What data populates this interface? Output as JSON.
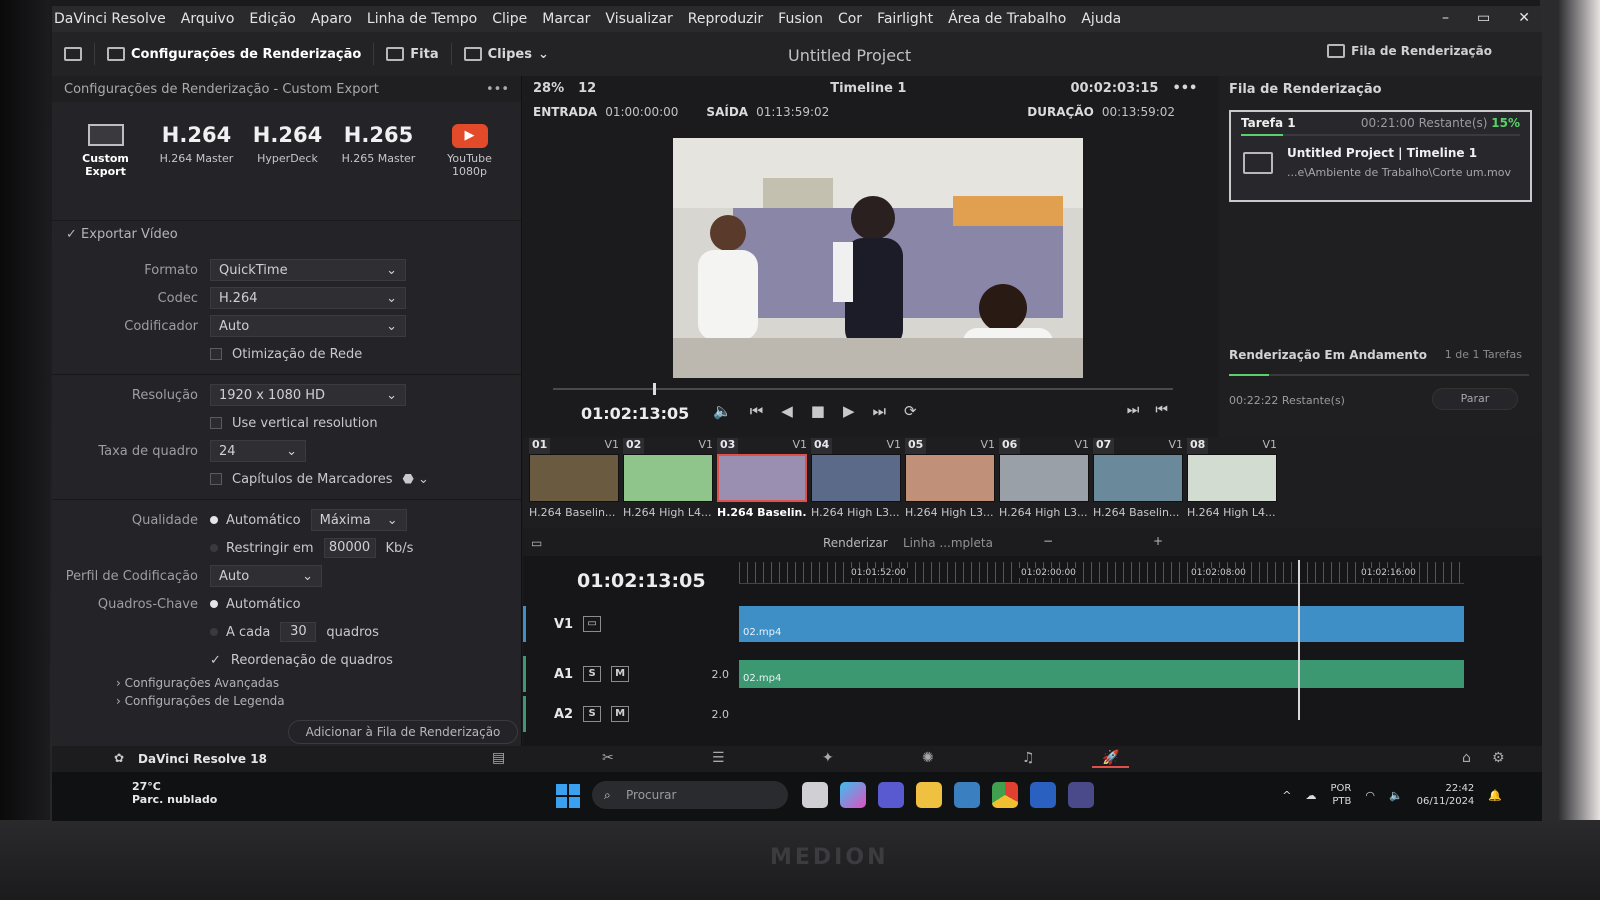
{
  "menu": [
    "DaVinci Resolve",
    "Arquivo",
    "Edição",
    "Aparo",
    "Linha de Tempo",
    "Clipe",
    "Marcar",
    "Visualizar",
    "Reproduzir",
    "Fusion",
    "Cor",
    "Fairlight",
    "Área de Trabalho",
    "Ajuda"
  ],
  "toolbar": {
    "render_settings": "Configurações de Renderização",
    "tape": "Fita",
    "clips": "Clipes",
    "project_title": "Untitled Project",
    "render_queue": "Fila de Renderização"
  },
  "left_panel": {
    "header": "Configurações de Renderização - Custom Export",
    "presets": [
      {
        "big": "",
        "label": "Custom Export"
      },
      {
        "big": "H.264",
        "label": "H.264 Master"
      },
      {
        "big": "H.264",
        "label": "HyperDeck"
      },
      {
        "big": "H.265",
        "label": "H.265 Master"
      },
      {
        "big": "",
        "label": "YouTube 1080p"
      }
    ],
    "export_video": "Exportar Vídeo",
    "format_label": "Formato",
    "format_value": "QuickTime",
    "codec_label": "Codec",
    "codec_value": "H.264",
    "encoder_label": "Codificador",
    "encoder_value": "Auto",
    "net_opt": "Otimização de Rede",
    "resolution_label": "Resolução",
    "resolution_value": "1920 x 1080 HD",
    "vertical_res": "Use vertical resolution",
    "framerate_label": "Taxa de quadro",
    "framerate_value": "24",
    "chapters": "Capítulos de Marcadores",
    "quality_label": "Qualidade",
    "quality_auto": "Automático",
    "quality_value": "Máxima",
    "restrict": "Restringir em",
    "restrict_value": "80000",
    "restrict_unit": "Kb/s",
    "profile_label": "Perfil de Codificação",
    "profile_value": "Auto",
    "keyframes_label": "Quadros-Chave",
    "keyframes_auto": "Automático",
    "every": "A cada",
    "every_value": "30",
    "every_unit": "quadros",
    "reorder": "Reordenação de quadros",
    "advanced": "Configurações Avançadas",
    "subtitles": "Configurações de Legenda",
    "add_queue": "Adicionar à Fila de Renderização"
  },
  "viewer": {
    "zoom": "28%",
    "frames": "12",
    "timeline_name": "Timeline 1",
    "tc_top": "00:02:03:15",
    "in_label": "ENTRADA",
    "in_value": "01:00:00:00",
    "out_label": "SAÍDA",
    "out_value": "01:13:59:02",
    "dur_label": "DURAÇÃO",
    "dur_value": "00:13:59:02",
    "timecode": "01:02:13:05"
  },
  "render_queue": {
    "title": "Fila de Renderização",
    "job_name": "Tarefa 1",
    "job_remaining": "00:21:00 Restante(s)",
    "job_percent": "15%",
    "job_progress": 0.15,
    "job_project": "Untitled Project | Timeline 1",
    "job_path": "...e\\Ambiente de Trabalho\\Corte um.mov",
    "in_progress": "Renderização Em Andamento",
    "task_count": "1 de 1 Tarefas",
    "remaining": "00:22:22 Restante(s)",
    "stop": "Parar"
  },
  "clips": [
    {
      "num": "01",
      "track": "V1",
      "name": "H.264 Baselin...",
      "color": "#6a5a40"
    },
    {
      "num": "02",
      "track": "V1",
      "name": "H.264 High L4...",
      "color": "#8fc48a"
    },
    {
      "num": "03",
      "track": "V1",
      "name": "H.264 Baselin...",
      "color": "#9a8fb0"
    },
    {
      "num": "04",
      "track": "V1",
      "name": "H.264 High L3...",
      "color": "#5a6a88"
    },
    {
      "num": "05",
      "track": "V1",
      "name": "H.264 High L3...",
      "color": "#c09078"
    },
    {
      "num": "06",
      "track": "V1",
      "name": "H.264 High L3...",
      "color": "#9aa0a8"
    },
    {
      "num": "07",
      "track": "V1",
      "name": "H.264 Baselin...",
      "color": "#6a8a9c"
    },
    {
      "num": "08",
      "track": "V1",
      "name": "H.264 High L4...",
      "color": "#d2dcd0"
    }
  ],
  "timeline": {
    "render_label": "Renderizar",
    "render_mode": "Linha ...mpleta",
    "timecode": "01:02:13:05",
    "ruler": [
      "01:01:52:00",
      "01:02:00:00",
      "01:02:08:00",
      "01:02:16:00"
    ],
    "v1": "V1",
    "a1": "A1",
    "a2": "A2",
    "a1_vol": "2.0",
    "a2_vol": "2.0",
    "clip_v": "02.mp4",
    "clip_a": "02.mp4"
  },
  "status": {
    "version": "DaVinci Resolve 18"
  },
  "taskbar": {
    "temp": "27°C",
    "weather": "Parc. nublado",
    "search": "Procurar",
    "lang1": "POR",
    "lang2": "PTB",
    "time": "22:42",
    "date": "06/11/2024"
  },
  "brand": "MEDION"
}
